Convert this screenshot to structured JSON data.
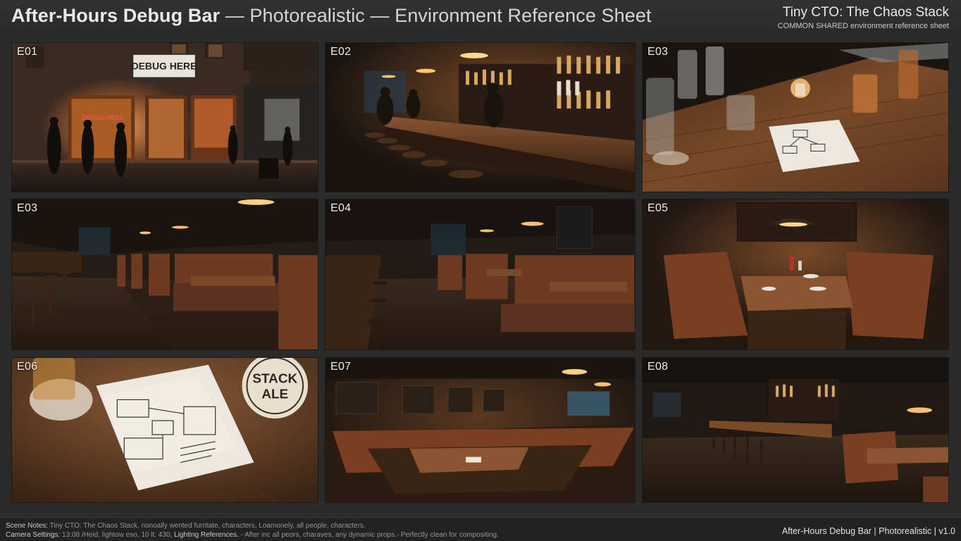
{
  "header": {
    "title_bold": "After-Hours Debug Bar",
    "title_rest": " — Photorealistic — Environment Reference Sheet",
    "brand_title": "Tiny CTO: The Chaos Stack",
    "brand_subtitle": "COMMON SHARED environment reference sheet"
  },
  "panels": [
    {
      "label": "E01",
      "sign": "DEBUG HERE",
      "neon": "DEBUG HERE"
    },
    {
      "label": "E02"
    },
    {
      "label": "E03"
    },
    {
      "label": "E03"
    },
    {
      "label": "E04"
    },
    {
      "label": "E05"
    },
    {
      "label": "E06",
      "coaster_line1": "STACK",
      "coaster_line2": "ALE"
    },
    {
      "label": "E07"
    },
    {
      "label": "E08"
    }
  ],
  "footer": {
    "scene_notes_label": "Scene Notes:",
    "scene_notes_text": "  Tiny CTO: The Chaos Stack,  nonoally wented furntate, characters, Loamonely, all people, characters.",
    "camera_label": "Camera Settings:",
    "camera_text": " 13:08 /Heid, lightow eso, 10 lt: 430,",
    "lighting_label": " Lighting References.",
    "lighting_text": " - After inc all peors, charaves, any dynamic props.- Perfectly clean for compositing.",
    "version": "After-Hours Debug Bar | Photorealistic | v1.0"
  },
  "colors": {
    "background": "#2b2b2b",
    "warm_light": "#f0b060",
    "wood": "#6b3f22",
    "leather": "#7a4026"
  }
}
